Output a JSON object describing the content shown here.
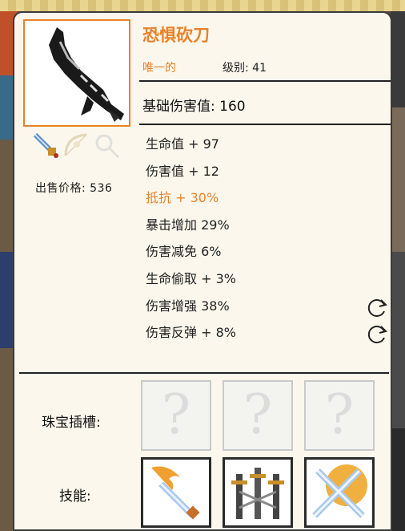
{
  "item": {
    "name": "恐惧砍刀",
    "rarity": "唯一的",
    "level_text": "级别: 41",
    "base_damage": "基础伤害值: 160",
    "sell_price": "出售价格: 536"
  },
  "stats": [
    {
      "text": "生命值 + 97",
      "highlight": false,
      "reroll": false
    },
    {
      "text": "伤害值 + 12",
      "highlight": false,
      "reroll": false
    },
    {
      "text": "抵抗 + 30%",
      "highlight": true,
      "reroll": false
    },
    {
      "text": "暴击增加 29%",
      "highlight": false,
      "reroll": false
    },
    {
      "text": "伤害减免 6%",
      "highlight": false,
      "reroll": false
    },
    {
      "text": "生命偷取 + 3%",
      "highlight": false,
      "reroll": false
    },
    {
      "text": "伤害增强 38%",
      "highlight": false,
      "reroll": true
    },
    {
      "text": "伤害反弹 + 8%",
      "highlight": false,
      "reroll": true
    }
  ],
  "gem_slots": {
    "label": "珠宝插槽:",
    "slots": [
      "?",
      "?",
      "?"
    ]
  },
  "skills": {
    "label": "技能:",
    "icons": [
      "skill-flame-sword-icon",
      "skill-triple-swords-icon",
      "skill-crossed-swords-icon"
    ]
  },
  "colors": {
    "accent": "#e8822a",
    "panel": "#fbf7ec"
  }
}
